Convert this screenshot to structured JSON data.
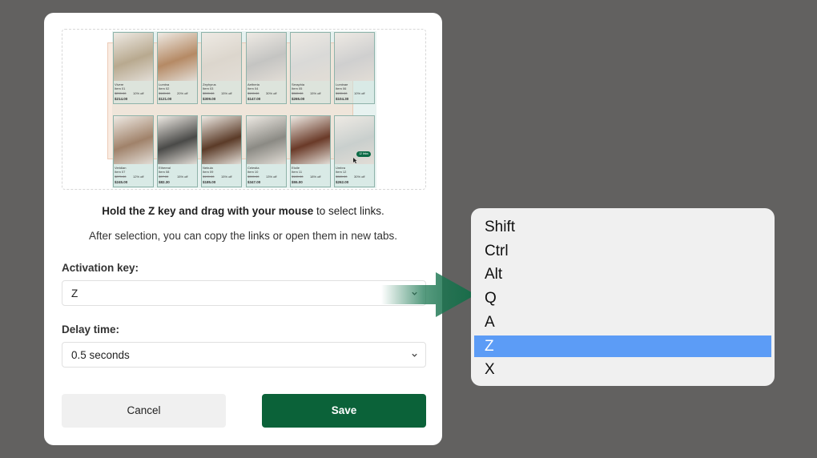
{
  "preview": {
    "cards": [
      {
        "brand": "Vivere",
        "name": "Item 01",
        "old": "$299.00",
        "off": "10% off",
        "price": "$214.00",
        "color": "#b8a98f"
      },
      {
        "brand": "Lumina",
        "name": "Item 02",
        "old": "$189.00",
        "off": "20% off",
        "price": "$121.00",
        "color": "#b58a65"
      },
      {
        "brand": "Zephyrus",
        "name": "Item 03",
        "old": "$399.00",
        "off": "15% off",
        "price": "$309.00",
        "color": "#dcd6cd"
      },
      {
        "brand": "Aetheria",
        "name": "Item 04",
        "old": "$199.00",
        "off": "30% off",
        "price": "$147.00",
        "color": "#c4c4c2"
      },
      {
        "brand": "Seraphia",
        "name": "Item 05",
        "old": "$389.00",
        "off": "15% off",
        "price": "$265.00",
        "color": "#d9d9d7"
      },
      {
        "brand": "Luminae",
        "name": "Item 06",
        "old": "$139.00",
        "off": "10% off",
        "price": "$104.30",
        "color": "#cfcfcf"
      },
      {
        "brand": "Veridian",
        "name": "Item 07",
        "old": "$279.00",
        "off": "12% off",
        "price": "$245.00",
        "color": "#a0826a"
      },
      {
        "brand": "Ethereal",
        "name": "Item 08",
        "old": "$97.00",
        "off": "15% off",
        "price": "$82.30",
        "color": "#4a4a48"
      },
      {
        "brand": "Nebula",
        "name": "Item 09",
        "old": "$199.00",
        "off": "15% off",
        "price": "$185.00",
        "color": "#5b3b28"
      },
      {
        "brand": "Celestia",
        "name": "Item 10",
        "old": "$399.00",
        "off": "13% off",
        "price": "$347.00",
        "color": "#8b8a84"
      },
      {
        "brand": "Etoile",
        "name": "Item 11",
        "old": "$189.00",
        "off": "18% off",
        "price": "$55.00",
        "color": "#6a3a28"
      },
      {
        "brand": "Umbra",
        "name": "Item 12",
        "old": "$389.00",
        "off": "30% off",
        "price": "$262.00",
        "color": "#c9cfcd"
      }
    ],
    "badge": "12 links"
  },
  "instructions": {
    "line1_bold": "Hold the Z key and drag with your mouse",
    "line1_rest": " to select links.",
    "line2": "After selection, you can copy the links or open them in new tabs."
  },
  "activation": {
    "label": "Activation key:",
    "value": "Z"
  },
  "delay": {
    "label": "Delay time:",
    "value": "0.5 seconds"
  },
  "buttons": {
    "cancel": "Cancel",
    "save": "Save"
  },
  "dropdown": {
    "options": [
      "Shift",
      "Ctrl",
      "Alt",
      "Q",
      "A",
      "Z",
      "X"
    ],
    "selected_index": 5
  },
  "colors": {
    "accent": "#0b6239",
    "selection": "#5c9cf6",
    "backdrop": "#626160"
  }
}
